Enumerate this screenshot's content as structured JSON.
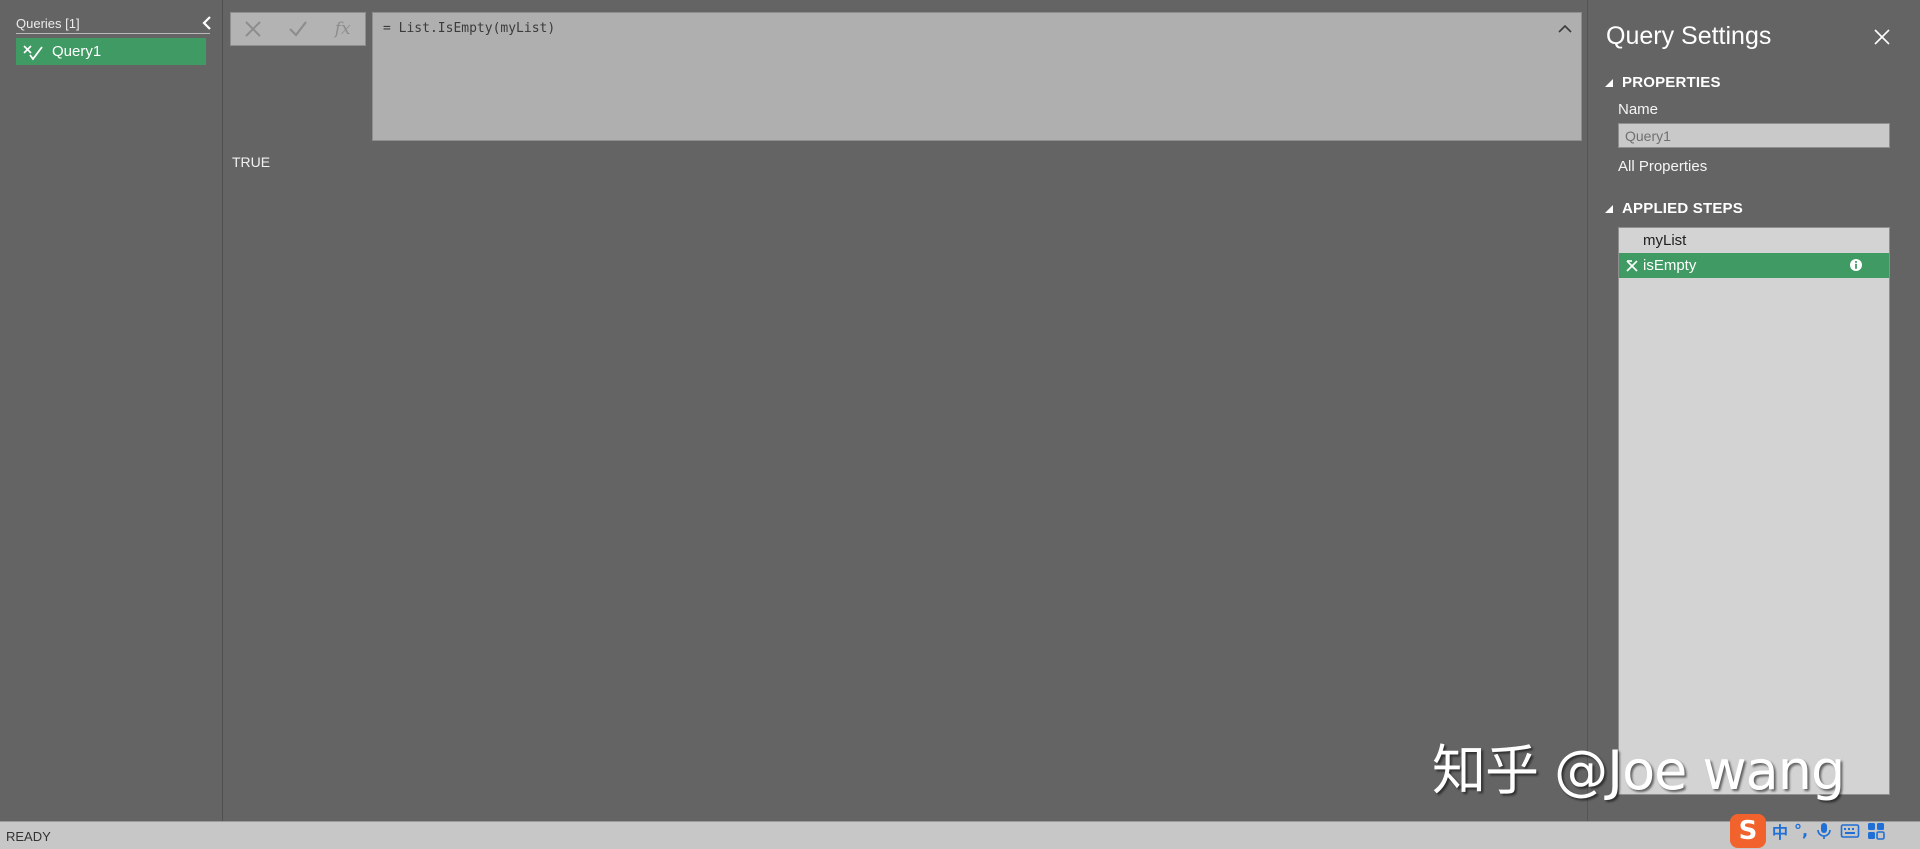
{
  "queries_pane": {
    "header": "Queries [1]",
    "items": [
      {
        "label": "Query1",
        "selected": true
      }
    ]
  },
  "formula_bar": {
    "fx_label": "fx",
    "formula": "= List.IsEmpty(myList)"
  },
  "result": {
    "value": "TRUE"
  },
  "query_settings": {
    "title": "Query Settings",
    "properties_header": "PROPERTIES",
    "name_label": "Name",
    "name_value": "Query1",
    "all_properties_link": "All Properties",
    "applied_steps_header": "APPLIED STEPS",
    "steps": [
      {
        "label": "myList",
        "selected": false
      },
      {
        "label": "isEmpty",
        "selected": true
      }
    ]
  },
  "status_bar": {
    "text": "READY"
  },
  "ime_tray": {
    "logo": "S",
    "mode": "中",
    "punct": "°,"
  },
  "watermark": "知乎 @Joe wang",
  "colors": {
    "background": "#646464",
    "selected": "#3f9a63",
    "formula_bg": "#afafaf",
    "status_bar": "#c7c7c7"
  },
  "icons": {
    "collapse": "chevron-left-icon",
    "query": "function-icon",
    "cancel": "x-icon",
    "commit": "check-icon",
    "expand_formula": "chevron-up-icon",
    "close": "close-icon",
    "section_toggle": "triangle-down-icon",
    "step_delete": "delete-x-icon",
    "step_info": "info-icon"
  }
}
